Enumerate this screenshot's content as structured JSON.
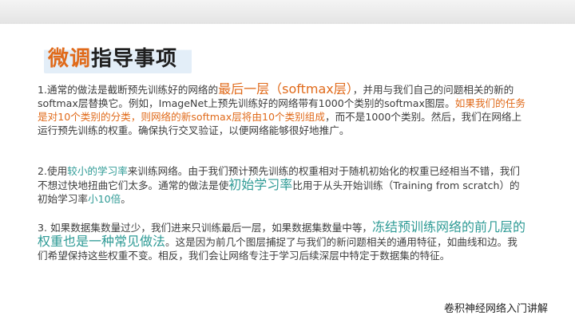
{
  "title": {
    "highlight": "微调",
    "rest": "指导事项"
  },
  "p1": {
    "a": "1.通常的做法是截断预先训练好的网络的",
    "b": "最后一层（softmax层）",
    "c": "，并用与我们自己的问题相关的新的softmax层替换它。例如，ImageNet上预先训练好的网络带有1000个类别的softmax图层。",
    "d": "如果我们的任务是对10个类别的分类，则网络的新softmax层将由10个类别组成",
    "e": "，而不是1000个类别。然后，我们在网络上运行预先训练的权重。确保执行交叉验证，以便网络能够很好地推广。"
  },
  "p2": {
    "a": "2.使用",
    "b": "较小的学习率",
    "c": "来训练网络。由于我们预计预先训练的权重相对于随机初始化的权重已经相当不错，我们不想过快地扭曲它们太多。通常的做法是使",
    "d": "初始学习率",
    "e": "比用于从头开始训练（Training from scratch）的初始学习率",
    "f": "小10倍",
    "g": "。"
  },
  "p3": {
    "a": "3. 如果数据集数量过少，我们进来只训练最后一层，如果数据集数量中等，",
    "b": "冻结预训练网络的前几层的权重也是一种常见做法",
    "c": "。这是因为前几个图层捕捉了与我们的新问题相关的通用特征，如曲线和边。我们希望保持这些权重不变。相反，我们会让网络专注于学习后续深层中特定于数据集的特征。"
  },
  "footer": "卷积神经网络入门讲解",
  "colors": {
    "accent_orange": "#e06a1a",
    "accent_teal": "#2f9b96",
    "title_bg": "#e3eef8"
  }
}
